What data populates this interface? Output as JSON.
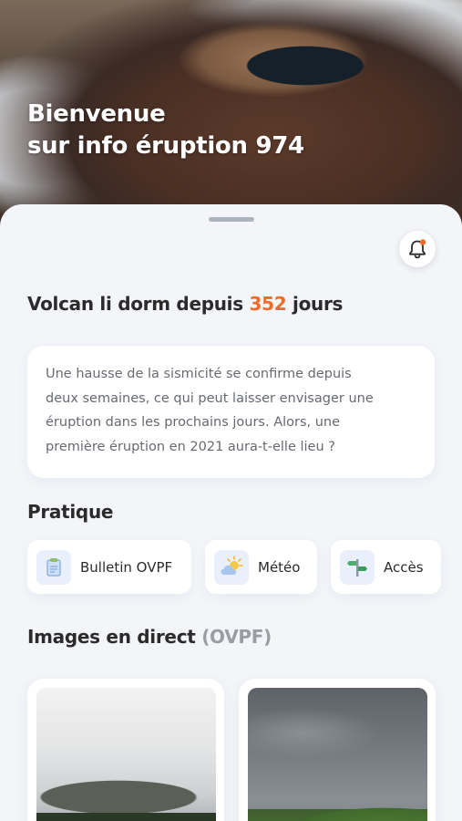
{
  "hero": {
    "title_line1": "Bienvenue",
    "title_line2": "sur info éruption 974"
  },
  "notifications": {
    "icon": "bell-icon",
    "badge_color": "#f06a2a"
  },
  "status": {
    "prefix": "Volcan li dorm depuis",
    "days": "352",
    "suffix": "jours",
    "accent_color": "#f06a2a"
  },
  "info": {
    "line1": "Une hausse de la sismicité se confirme depuis",
    "line2": "deux semaines, ce qui peut laisser envisager une",
    "line3": "éruption dans les prochains jours. Alors, une",
    "line4": "première éruption en 2021 aura-t-elle lieu ?"
  },
  "practical": {
    "title": "Pratique",
    "items": [
      {
        "label": "Bulletin OVPF",
        "icon": "clipboard-icon"
      },
      {
        "label": "Météo",
        "icon": "weather-sun-cloud-icon"
      },
      {
        "label": "Accès",
        "icon": "signpost-icon"
      }
    ]
  },
  "live": {
    "title": "Images en direct",
    "source": "(OVPF)",
    "images": [
      {
        "icon": "webcam-image-1"
      },
      {
        "icon": "webcam-image-2"
      }
    ]
  }
}
